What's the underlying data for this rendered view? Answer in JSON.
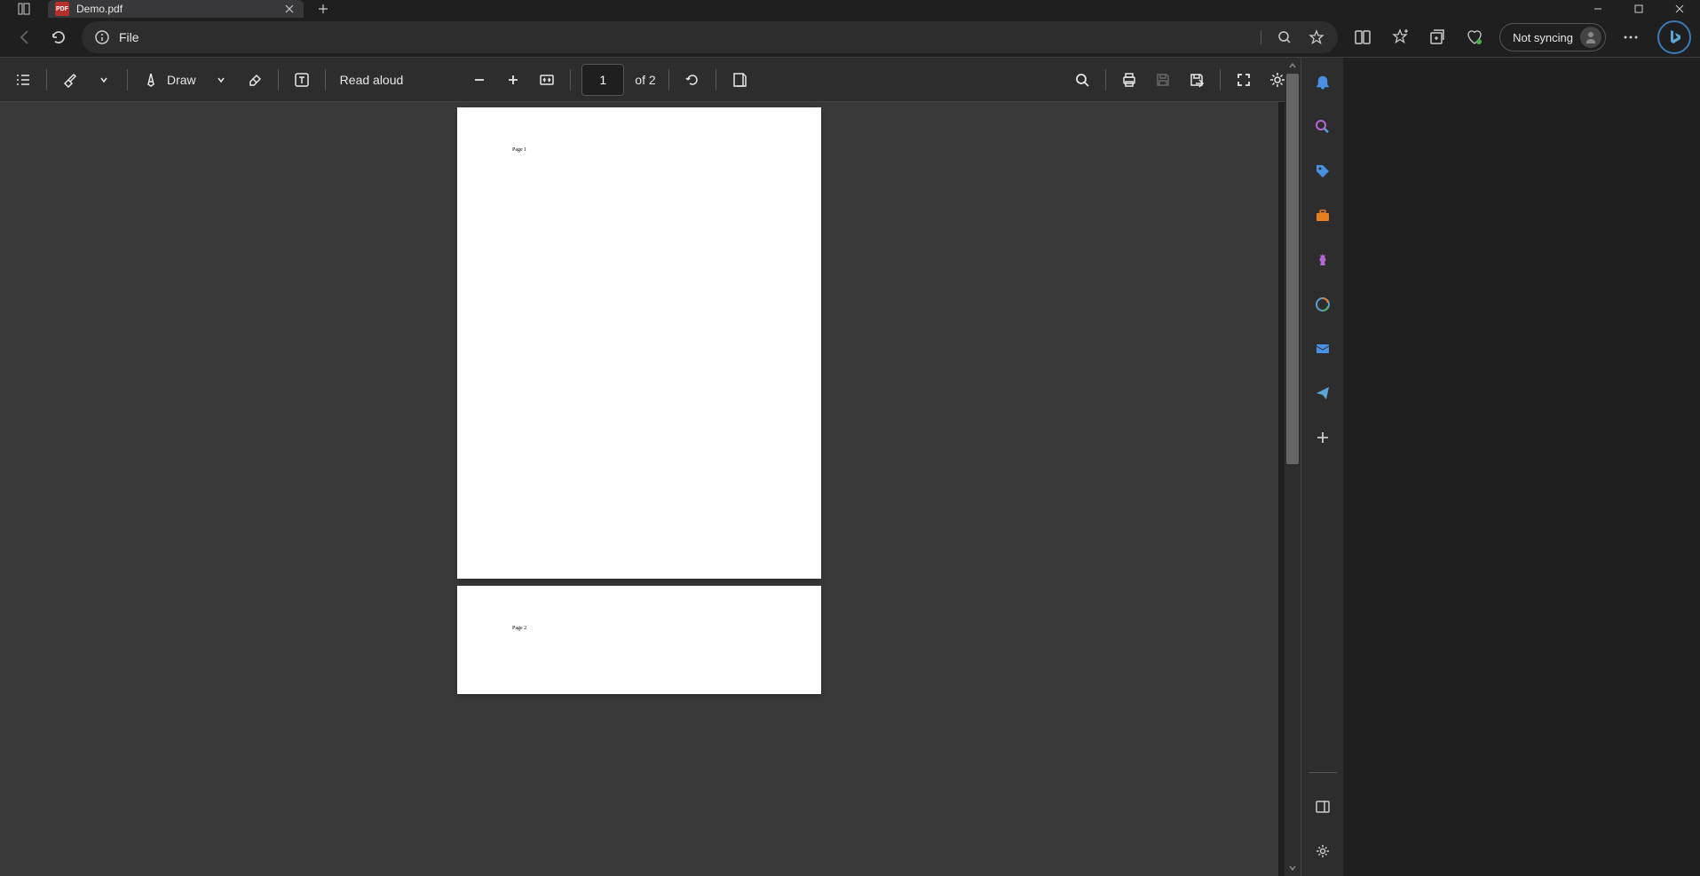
{
  "tab": {
    "title": "Demo.pdf",
    "icon_label": "PDF"
  },
  "address": {
    "protocol": "File"
  },
  "sync": {
    "label": "Not syncing"
  },
  "pdf_toolbar": {
    "draw_label": "Draw",
    "read_aloud_label": "Read aloud",
    "current_page": "1",
    "of_pages": "of 2"
  },
  "pages": {
    "page1_text": "Page 1",
    "page2_text": "Page 2"
  }
}
